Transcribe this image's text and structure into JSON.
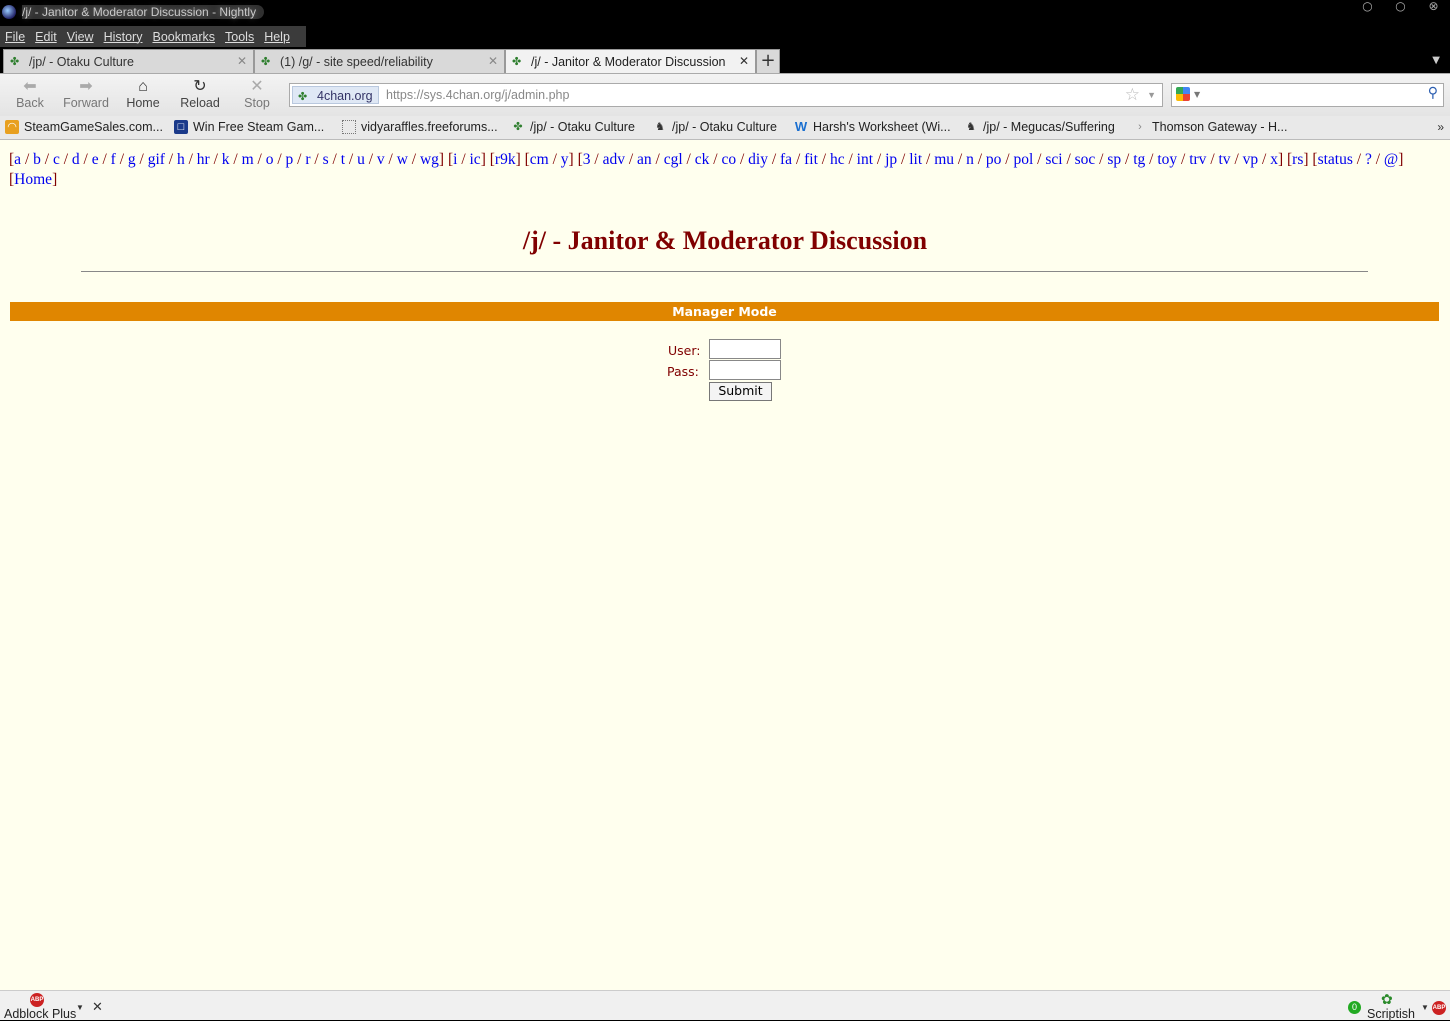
{
  "window": {
    "title": "/j/ - Janitor & Moderator Discussion - Nightly"
  },
  "menu": [
    "File",
    "Edit",
    "View",
    "History",
    "Bookmarks",
    "Tools",
    "Help"
  ],
  "tabs": [
    {
      "label": "/jp/ - Otaku Culture"
    },
    {
      "label": "(1) /g/ - site speed/reliability"
    },
    {
      "label": "/j/ - Janitor & Moderator Discussion"
    }
  ],
  "nav": {
    "back": "Back",
    "forward": "Forward",
    "home": "Home",
    "reload": "Reload",
    "stop": "Stop"
  },
  "urlbar": {
    "identity": "4chan.org",
    "url": "https://sys.4chan.org/j/admin.php"
  },
  "search": {
    "value": ""
  },
  "bookmarks": [
    {
      "label": "SteamGameSales.com..."
    },
    {
      "label": "Win Free Steam Gam..."
    },
    {
      "label": "vidyaraffles.freeforums..."
    },
    {
      "label": "/jp/ - Otaku Culture"
    },
    {
      "label": "/jp/ - Otaku Culture"
    },
    {
      "label": "Harsh's Worksheet (Wi..."
    },
    {
      "label": "/jp/ - Megucas/Suffering"
    },
    {
      "label": "Thomson Gateway - H..."
    }
  ],
  "boardnav": {
    "groups": [
      [
        "a",
        "b",
        "c",
        "d",
        "e",
        "f",
        "g",
        "gif",
        "h",
        "hr",
        "k",
        "m",
        "o",
        "p",
        "r",
        "s",
        "t",
        "u",
        "v",
        "w",
        "wg"
      ],
      [
        "i",
        "ic"
      ],
      [
        "r9k"
      ],
      [
        "cm",
        "y"
      ],
      [
        "3",
        "adv",
        "an",
        "cgl",
        "ck",
        "co",
        "diy",
        "fa",
        "fit",
        "hc",
        "int",
        "jp",
        "lit",
        "mu",
        "n",
        "po",
        "pol",
        "sci",
        "soc",
        "sp",
        "tg",
        "toy",
        "trv",
        "tv",
        "vp",
        "x"
      ],
      [
        "rs"
      ],
      [
        "status",
        "?",
        "@"
      ],
      [
        "Home"
      ]
    ]
  },
  "page": {
    "board_title": "/j/ - Janitor & Moderator Discussion",
    "manager_mode": "Manager Mode",
    "user_label": "User:",
    "pass_label": "Pass:",
    "user_value": "",
    "pass_value": "",
    "submit_label": "Submit"
  },
  "statusbar": {
    "adblock": "Adblock Plus",
    "scriptish": "Scriptish",
    "scriptish_count": "0"
  },
  "colors": {
    "board_title": "#800000",
    "manager_bar": "#e08600",
    "link": "#0000ee",
    "page_bg": "#ffffee"
  }
}
